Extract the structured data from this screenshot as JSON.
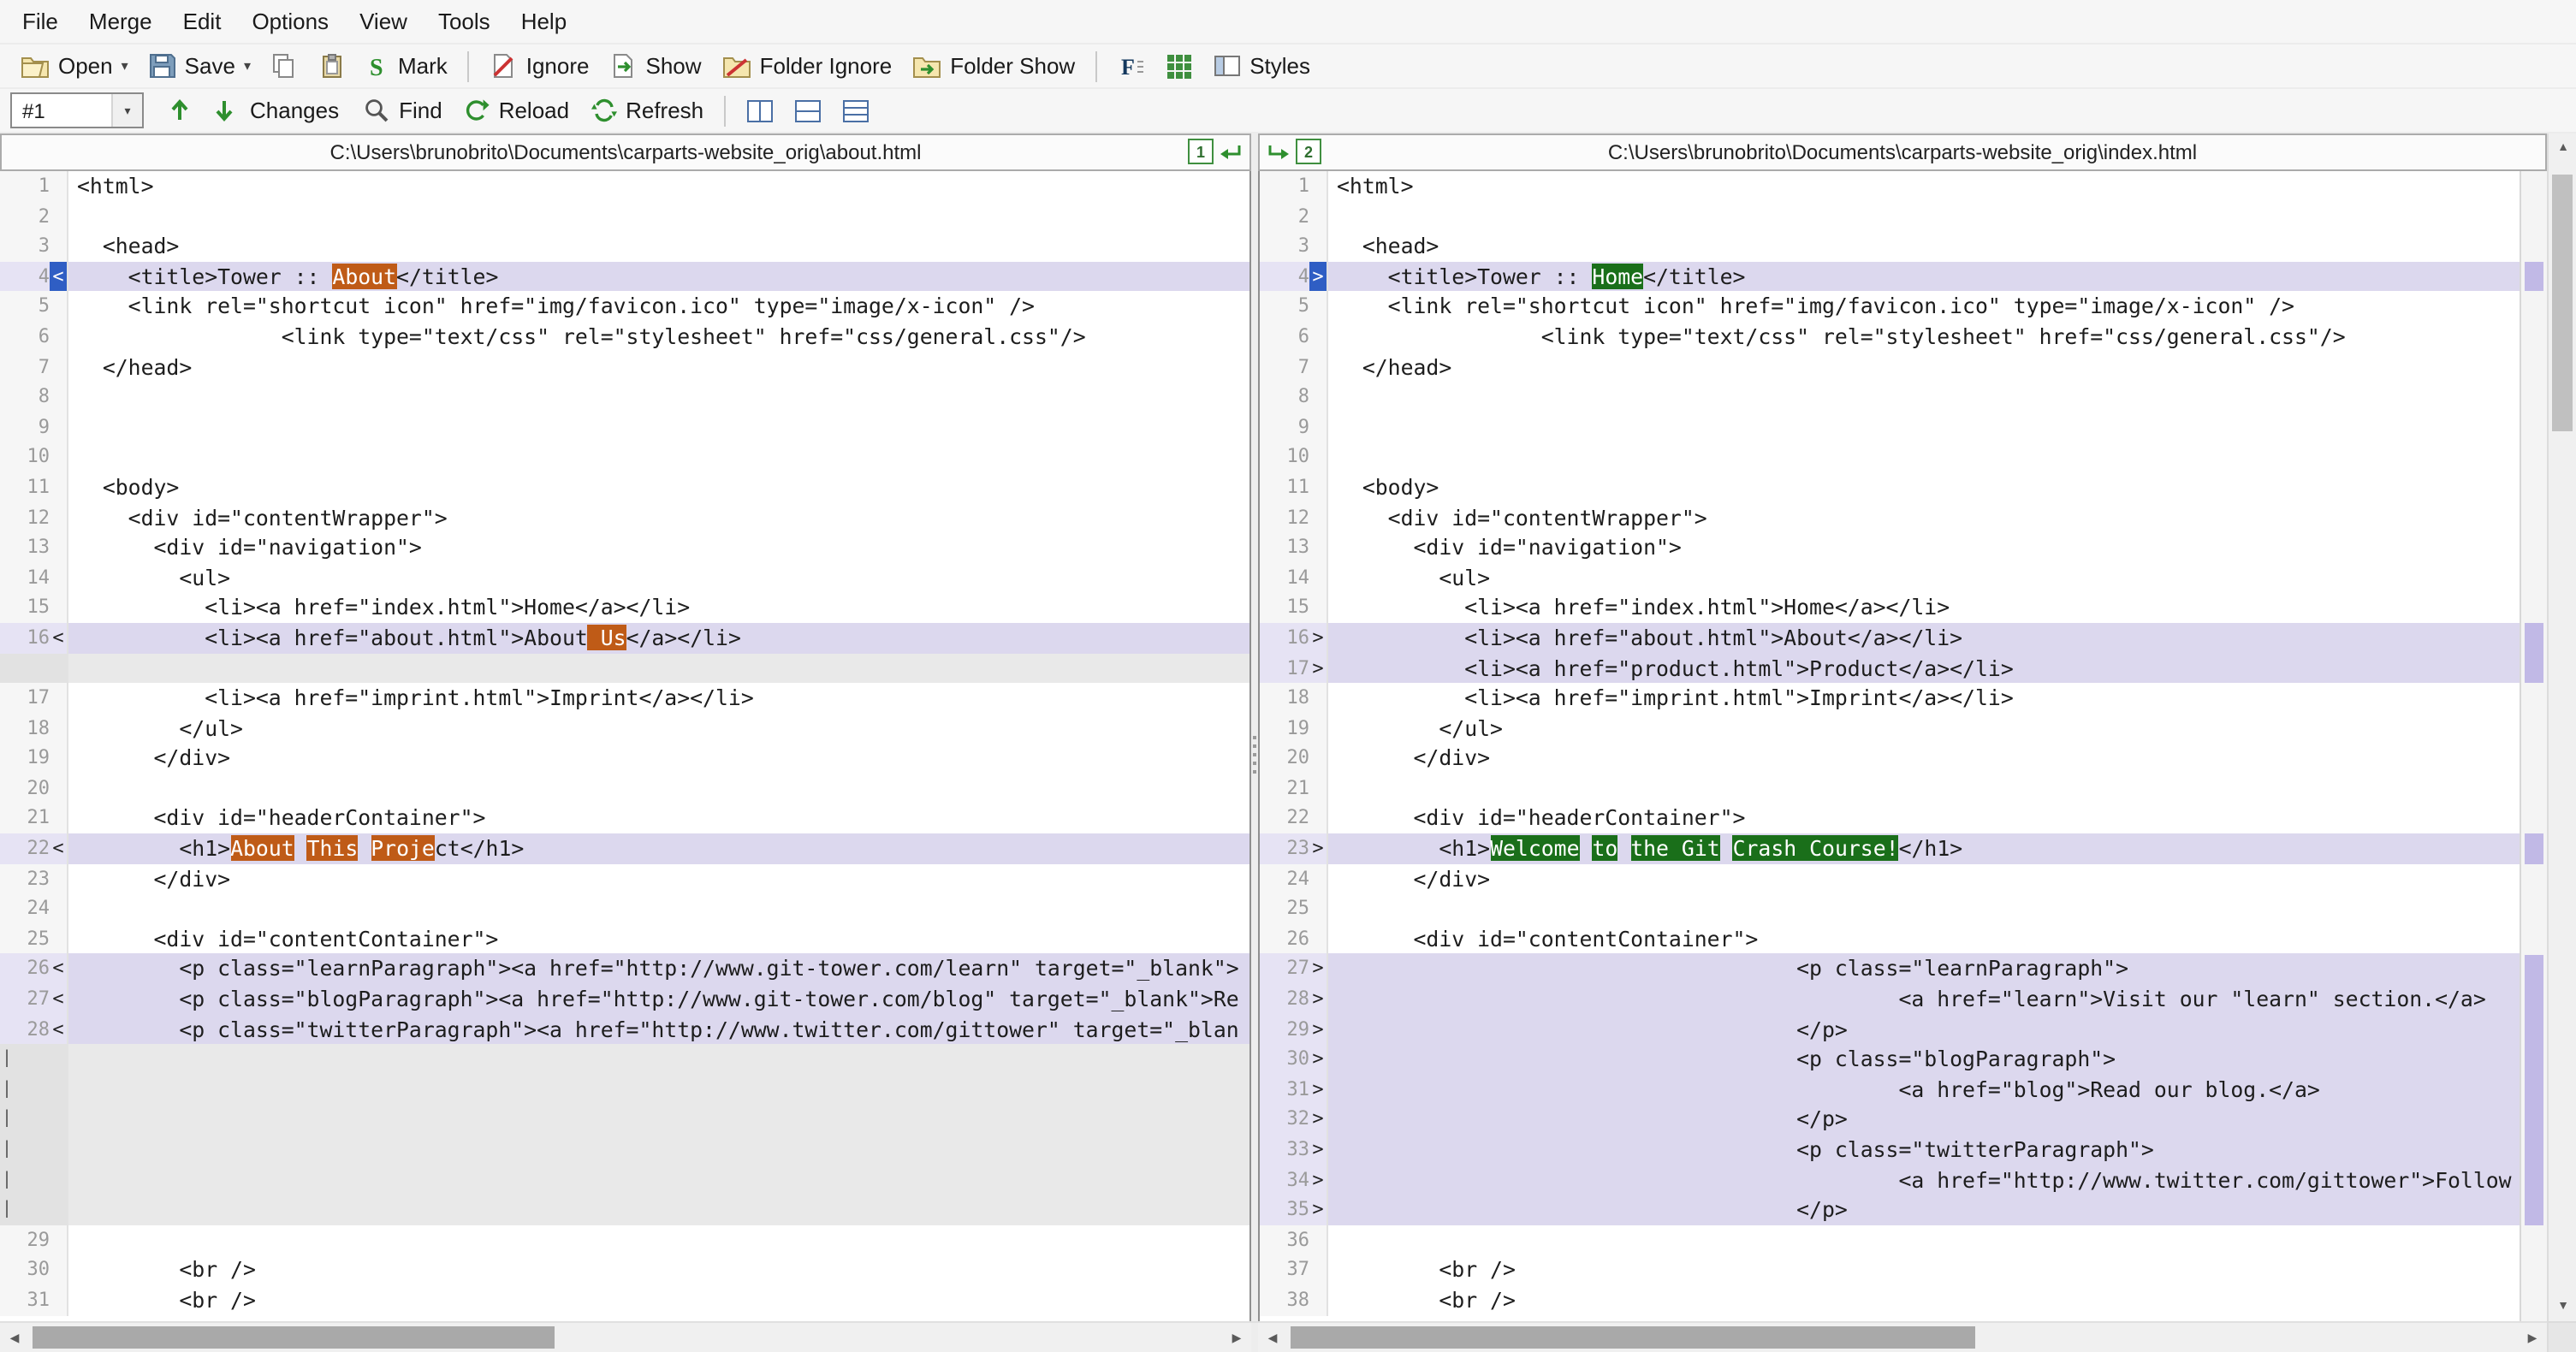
{
  "colors": {
    "diff_bg": "#dcd8ee",
    "diff_gutter_bg": "#e6e3f4",
    "gap_bg": "#e9e9e9",
    "word_del_bg": "#bf5b17",
    "word_ins_bg": "#1a6f1a",
    "marker_sel_bg": "#2f5ec4",
    "accent_green": "#2e8f2e"
  },
  "glyphs": {
    "caret": "▾",
    "scroll_up": "▲",
    "scroll_down": "▼",
    "scroll_left": "◀",
    "scroll_right": "▶"
  },
  "menu": {
    "items": [
      "File",
      "Merge",
      "Edit",
      "Options",
      "View",
      "Tools",
      "Help"
    ]
  },
  "toolbar": {
    "open": "Open",
    "save": "Save",
    "mark": "Mark",
    "ignore": "Ignore",
    "show": "Show",
    "folder_ignore": "Folder Ignore",
    "folder_show": "Folder Show",
    "styles": "Styles",
    "diff_number": "#1",
    "changes": "Changes",
    "find": "Find",
    "reload": "Reload",
    "refresh": "Refresh"
  },
  "headers": {
    "left_path": "C:\\Users\\brunobrito\\Documents\\carparts-website_orig\\about.html",
    "right_path": "C:\\Users\\brunobrito\\Documents\\carparts-website_orig\\index.html",
    "left_pane_badge": "1",
    "right_pane_badge": "2"
  },
  "panes": {
    "left": {
      "lines": [
        {
          "n": 1,
          "segs": [
            [
              "<html>",
              ""
            ]
          ]
        },
        {
          "n": 2,
          "segs": []
        },
        {
          "n": 3,
          "segs": [
            [
              "  <head>",
              ""
            ]
          ]
        },
        {
          "n": 4,
          "m": "<",
          "sel": true,
          "d": true,
          "segs": [
            [
              "    <title>Tower :: ",
              ""
            ],
            [
              "About",
              "del"
            ],
            [
              "</title>",
              ""
            ]
          ]
        },
        {
          "n": 5,
          "segs": [
            [
              "    <link rel=\"shortcut icon\" href=\"img/favicon.ico\" type=\"image/x-icon\" />",
              ""
            ]
          ]
        },
        {
          "n": 6,
          "segs": [
            [
              "                <link type=\"text/css\" rel=\"stylesheet\" href=\"css/general.css\"/>",
              ""
            ]
          ]
        },
        {
          "n": 7,
          "segs": [
            [
              "  </head>",
              ""
            ]
          ]
        },
        {
          "n": 8,
          "segs": []
        },
        {
          "n": 9,
          "segs": []
        },
        {
          "n": 10,
          "segs": []
        },
        {
          "n": 11,
          "segs": [
            [
              "  <body>",
              ""
            ]
          ]
        },
        {
          "n": 12,
          "segs": [
            [
              "    <div id=\"contentWrapper\">",
              ""
            ]
          ]
        },
        {
          "n": 13,
          "segs": [
            [
              "      <div id=\"navigation\">",
              ""
            ]
          ]
        },
        {
          "n": 14,
          "segs": [
            [
              "        <ul>",
              ""
            ]
          ]
        },
        {
          "n": 15,
          "segs": [
            [
              "          <li><a href=\"index.html\">Home</a></li>",
              ""
            ]
          ]
        },
        {
          "n": 16,
          "m": "<",
          "d": true,
          "segs": [
            [
              "          <li><a href=\"about.html\">About",
              ""
            ],
            [
              " Us",
              "del"
            ],
            [
              "</a></li>",
              ""
            ]
          ]
        },
        {
          "gap": true
        },
        {
          "n": 17,
          "segs": [
            [
              "          <li><a href=\"imprint.html\">Imprint</a></li>",
              ""
            ]
          ]
        },
        {
          "n": 18,
          "segs": [
            [
              "        </ul>",
              ""
            ]
          ]
        },
        {
          "n": 19,
          "segs": [
            [
              "      </div>",
              ""
            ]
          ]
        },
        {
          "n": 20,
          "segs": []
        },
        {
          "n": 21,
          "segs": [
            [
              "      <div id=\"headerContainer\">",
              ""
            ]
          ]
        },
        {
          "n": 22,
          "m": "<",
          "d": true,
          "segs": [
            [
              "        <h1>",
              ""
            ],
            [
              "About",
              "del"
            ],
            [
              " ",
              ""
            ],
            [
              "This",
              "del"
            ],
            [
              " ",
              ""
            ],
            [
              "Proje",
              "del"
            ],
            [
              "ct</h1>",
              ""
            ]
          ]
        },
        {
          "n": 23,
          "segs": [
            [
              "      </div>",
              ""
            ]
          ]
        },
        {
          "n": 24,
          "segs": []
        },
        {
          "n": 25,
          "segs": [
            [
              "      <div id=\"contentContainer\">",
              ""
            ]
          ]
        },
        {
          "n": 26,
          "m": "<",
          "d": true,
          "segs": [
            [
              "        <p class=\"learnParagraph\"><a href=\"http://www.git-tower.com/learn\" target=\"_blank\">",
              ""
            ]
          ]
        },
        {
          "n": 27,
          "m": "<",
          "d": true,
          "segs": [
            [
              "        <p class=\"blogParagraph\"><a href=\"http://www.git-tower.com/blog\" target=\"_blank\">Re",
              ""
            ]
          ]
        },
        {
          "n": 28,
          "m": "<",
          "d": true,
          "segs": [
            [
              "        <p class=\"twitterParagraph\"><a href=\"http://www.twitter.com/gittower\" target=\"_blan",
              ""
            ]
          ]
        },
        {
          "gap": true,
          "bar": true
        },
        {
          "gap": true,
          "bar": true
        },
        {
          "gap": true,
          "bar": true
        },
        {
          "gap": true,
          "bar": true
        },
        {
          "gap": true,
          "bar": true
        },
        {
          "gap": true,
          "bar": true
        },
        {
          "n": 29,
          "segs": []
        },
        {
          "n": 30,
          "segs": [
            [
              "        <br />",
              ""
            ]
          ]
        },
        {
          "n": 31,
          "segs": [
            [
              "        <br />",
              ""
            ]
          ]
        }
      ]
    },
    "right": {
      "lines": [
        {
          "n": 1,
          "segs": [
            [
              "<html>",
              ""
            ]
          ]
        },
        {
          "n": 2,
          "segs": []
        },
        {
          "n": 3,
          "segs": [
            [
              "  <head>",
              ""
            ]
          ]
        },
        {
          "n": 4,
          "m": ">",
          "sel": true,
          "d": true,
          "segs": [
            [
              "    <title>Tower :: ",
              ""
            ],
            [
              "Home",
              "ins"
            ],
            [
              "</title>",
              ""
            ]
          ]
        },
        {
          "n": 5,
          "segs": [
            [
              "    <link rel=\"shortcut icon\" href=\"img/favicon.ico\" type=\"image/x-icon\" />",
              ""
            ]
          ]
        },
        {
          "n": 6,
          "segs": [
            [
              "                <link type=\"text/css\" rel=\"stylesheet\" href=\"css/general.css\"/>",
              ""
            ]
          ]
        },
        {
          "n": 7,
          "segs": [
            [
              "  </head>",
              ""
            ]
          ]
        },
        {
          "n": 8,
          "segs": []
        },
        {
          "n": 9,
          "segs": []
        },
        {
          "n": 10,
          "segs": []
        },
        {
          "n": 11,
          "segs": [
            [
              "  <body>",
              ""
            ]
          ]
        },
        {
          "n": 12,
          "segs": [
            [
              "    <div id=\"contentWrapper\">",
              ""
            ]
          ]
        },
        {
          "n": 13,
          "segs": [
            [
              "      <div id=\"navigation\">",
              ""
            ]
          ]
        },
        {
          "n": 14,
          "segs": [
            [
              "        <ul>",
              ""
            ]
          ]
        },
        {
          "n": 15,
          "segs": [
            [
              "          <li><a href=\"index.html\">Home</a></li>",
              ""
            ]
          ]
        },
        {
          "n": 16,
          "m": ">",
          "d": true,
          "segs": [
            [
              "          <li><a href=\"about.html\">About</a></li>",
              ""
            ]
          ]
        },
        {
          "n": 17,
          "m": ">",
          "d": true,
          "segs": [
            [
              "          <li><a href=\"product.html\">Product</a></li>",
              ""
            ]
          ]
        },
        {
          "n": 18,
          "segs": [
            [
              "          <li><a href=\"imprint.html\">Imprint</a></li>",
              ""
            ]
          ]
        },
        {
          "n": 19,
          "segs": [
            [
              "        </ul>",
              ""
            ]
          ]
        },
        {
          "n": 20,
          "segs": [
            [
              "      </div>",
              ""
            ]
          ]
        },
        {
          "n": 21,
          "segs": []
        },
        {
          "n": 22,
          "segs": [
            [
              "      <div id=\"headerContainer\">",
              ""
            ]
          ]
        },
        {
          "n": 23,
          "m": ">",
          "d": true,
          "segs": [
            [
              "        <h1>",
              ""
            ],
            [
              "Welcome",
              "ins"
            ],
            [
              " ",
              ""
            ],
            [
              "to",
              "ins"
            ],
            [
              " ",
              ""
            ],
            [
              "the Git",
              "ins"
            ],
            [
              " ",
              ""
            ],
            [
              "Crash Course!",
              "ins"
            ],
            [
              "</h1>",
              ""
            ]
          ]
        },
        {
          "n": 24,
          "segs": [
            [
              "      </div>",
              ""
            ]
          ]
        },
        {
          "n": 25,
          "segs": []
        },
        {
          "n": 26,
          "segs": [
            [
              "      <div id=\"contentContainer\">",
              ""
            ]
          ]
        },
        {
          "n": 27,
          "m": ">",
          "d": true,
          "segs": [
            [
              "                                    <p class=\"learnParagraph\">",
              ""
            ]
          ]
        },
        {
          "n": 28,
          "m": ">",
          "d": true,
          "segs": [
            [
              "                                            <a href=\"learn\">Visit our \"learn\" section.</a>",
              ""
            ]
          ]
        },
        {
          "n": 29,
          "m": ">",
          "d": true,
          "segs": [
            [
              "                                    </p>",
              ""
            ]
          ]
        },
        {
          "n": 30,
          "m": ">",
          "d": true,
          "segs": [
            [
              "                                    <p class=\"blogParagraph\">",
              ""
            ]
          ]
        },
        {
          "n": 31,
          "m": ">",
          "d": true,
          "segs": [
            [
              "                                            <a href=\"blog\">Read our blog.</a>",
              ""
            ]
          ]
        },
        {
          "n": 32,
          "m": ">",
          "d": true,
          "segs": [
            [
              "                                    </p>",
              ""
            ]
          ]
        },
        {
          "n": 33,
          "m": ">",
          "d": true,
          "segs": [
            [
              "                                    <p class=\"twitterParagraph\">",
              ""
            ]
          ]
        },
        {
          "n": 34,
          "m": ">",
          "d": true,
          "segs": [
            [
              "                                            <a href=\"http://www.twitter.com/gittower\">Follow",
              ""
            ]
          ]
        },
        {
          "n": 35,
          "m": ">",
          "d": true,
          "segs": [
            [
              "                                    </p>",
              ""
            ]
          ]
        },
        {
          "n": 36,
          "segs": []
        },
        {
          "n": 37,
          "segs": [
            [
              "        <br />",
              ""
            ]
          ]
        },
        {
          "n": 38,
          "segs": [
            [
              "        <br />",
              ""
            ]
          ]
        }
      ]
    }
  },
  "scrollbar": {
    "row_height": 17.6
  }
}
